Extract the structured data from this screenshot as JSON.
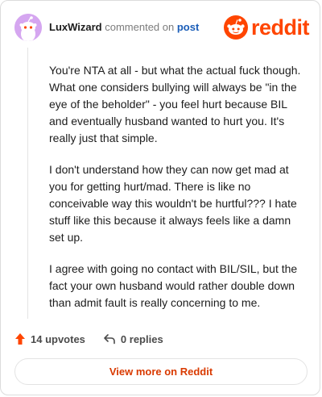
{
  "comment": {
    "username": "LuxWizard",
    "action_text": "commented on",
    "post_link": "post"
  },
  "brand": {
    "wordmark": "reddit",
    "accent_color": "#ff4500"
  },
  "body": {
    "paragraphs": [
      "You're NTA at all - but what the actual fuck though. What one considers bullying will always be \"in the eye of the beholder\" - you feel hurt because BIL and eventually husband wanted to hurt you. It's really just that simple.",
      "I don't understand how they can now get mad at you for getting hurt/mad. There is like no conceivable way this wouldn't be hurtful??? I hate stuff like this because it always feels like a damn set up.",
      "I agree with going no contact with BIL/SIL, but the fact your own husband would rather double down than admit fault is really concerning to me."
    ]
  },
  "footer": {
    "upvotes_label": "14 upvotes",
    "replies_label": "0 replies",
    "view_more_label": "View more on Reddit"
  }
}
